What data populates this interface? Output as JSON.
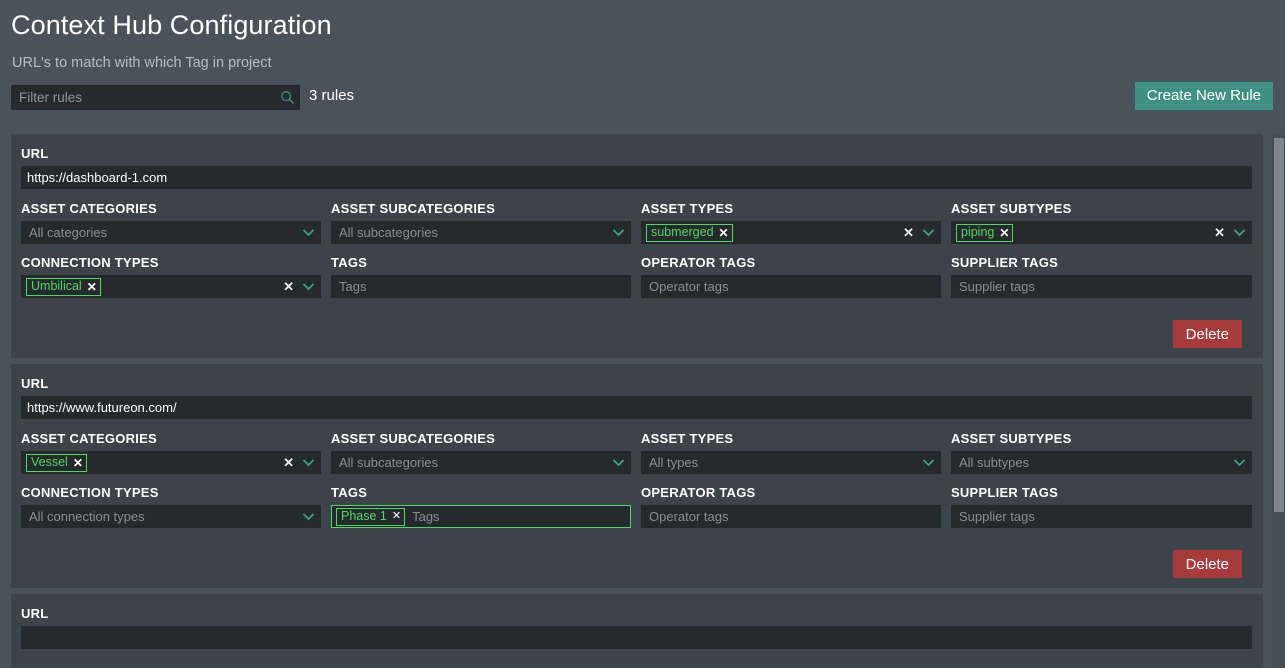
{
  "header": {
    "title": "Context Hub Configuration",
    "subtitle": "URL's to match with which Tag in project"
  },
  "toolbar": {
    "filter_placeholder": "Filter rules",
    "filter_value": "",
    "search_icon": "search-icon",
    "rules_count": "3 rules",
    "create_label": "Create New Rule"
  },
  "colors": {
    "page_bg": "#4a525b",
    "card_bg": "#3c434b",
    "input_bg": "#262a2c",
    "accent_teal": "#3f9283",
    "chip_green": "#4cd964",
    "danger_red": "#a83a3a",
    "scrollbar_thumb": "#7e868c"
  },
  "labels": {
    "url": "URL",
    "asset_categories": "ASSET CATEGORIES",
    "asset_subcategories": "ASSET SUBCATEGORIES",
    "asset_types": "ASSET TYPES",
    "asset_subtypes": "ASSET SUBTYPES",
    "connection_types": "CONNECTION TYPES",
    "tags": "TAGS",
    "operator_tags": "OPERATOR TAGS",
    "supplier_tags": "SUPPLIER TAGS",
    "delete": "Delete"
  },
  "placeholders": {
    "asset_categories": "All categories",
    "asset_subcategories": "All subcategories",
    "asset_types": "All types",
    "asset_subtypes": "All subtypes",
    "connection_types": "All connection types",
    "tags": "Tags",
    "operator_tags": "Operator tags",
    "supplier_tags": "Supplier tags"
  },
  "rules": [
    {
      "url": "https://dashboard-1.com",
      "asset_categories": {
        "chips": [],
        "placeholder": "All categories",
        "has_clear": false,
        "focused": false
      },
      "asset_subcategories": {
        "chips": [],
        "placeholder": "All subcategories",
        "has_clear": false,
        "focused": false
      },
      "asset_types": {
        "chips": [
          "submerged"
        ],
        "placeholder": "",
        "has_clear": true,
        "focused": false
      },
      "asset_subtypes": {
        "chips": [
          "piping"
        ],
        "placeholder": "",
        "has_clear": true,
        "focused": false
      },
      "connection_types": {
        "chips": [
          "Umbilical"
        ],
        "placeholder": "",
        "has_clear": true,
        "focused": false
      },
      "tags": {
        "chips": [],
        "placeholder": "Tags",
        "focused": false
      },
      "operator_tags": {
        "chips": [],
        "placeholder": "Operator tags",
        "focused": false
      },
      "supplier_tags": {
        "chips": [],
        "placeholder": "Supplier tags",
        "focused": false
      }
    },
    {
      "url": "https://www.futureon.com/",
      "asset_categories": {
        "chips": [
          "Vessel"
        ],
        "placeholder": "",
        "has_clear": true,
        "focused": false
      },
      "asset_subcategories": {
        "chips": [],
        "placeholder": "All subcategories",
        "has_clear": false,
        "focused": false
      },
      "asset_types": {
        "chips": [],
        "placeholder": "All types",
        "has_clear": false,
        "focused": false
      },
      "asset_subtypes": {
        "chips": [],
        "placeholder": "All subtypes",
        "has_clear": false,
        "focused": false
      },
      "connection_types": {
        "chips": [],
        "placeholder": "All connection types",
        "has_clear": false,
        "focused": false
      },
      "tags": {
        "chips": [
          "Phase 1"
        ],
        "placeholder": "Tags",
        "focused": true
      },
      "operator_tags": {
        "chips": [],
        "placeholder": "Operator tags",
        "focused": false
      },
      "supplier_tags": {
        "chips": [],
        "placeholder": "Supplier tags",
        "focused": false
      }
    },
    {
      "url": "",
      "partial": true
    }
  ]
}
